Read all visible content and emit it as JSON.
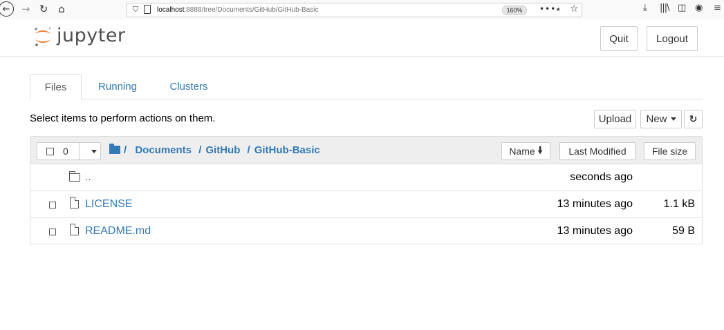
{
  "browser": {
    "url_host": "localhost",
    "url_rest": ":8888/tree/Documents/GitHub/GitHub-Basic",
    "zoom": "160%",
    "more": "•••",
    "back_icon": "←",
    "forward_icon": "→",
    "reload_icon": "↻",
    "home_icon": "⌂"
  },
  "header": {
    "logo_text": "jupyter",
    "quit_label": "Quit",
    "logout_label": "Logout"
  },
  "tabs": [
    {
      "label": "Files",
      "active": true
    },
    {
      "label": "Running",
      "active": false
    },
    {
      "label": "Clusters",
      "active": false
    }
  ],
  "toolbar": {
    "message": "Select items to perform actions on them.",
    "upload_label": "Upload",
    "new_label": "New",
    "refresh_icon": "↻"
  },
  "list_header": {
    "selected_count": "0",
    "breadcrumb": [
      "/",
      "Documents",
      "/",
      "GitHub",
      "/",
      "GitHub-Basic"
    ],
    "sort_name": "Name",
    "sort_name_arrow": "🡋",
    "sort_modified": "Last Modified",
    "sort_size": "File size"
  },
  "rows": [
    {
      "name": "..",
      "type": "folder",
      "modified": "seconds ago",
      "size": ""
    },
    {
      "name": "LICENSE",
      "type": "file",
      "modified": "13 minutes ago",
      "size": "1.1 kB"
    },
    {
      "name": "README.md",
      "type": "file",
      "modified": "13 minutes ago",
      "size": "59 B"
    }
  ],
  "colors": {
    "link": "#337ab7",
    "logo_orange": "#f37726"
  }
}
